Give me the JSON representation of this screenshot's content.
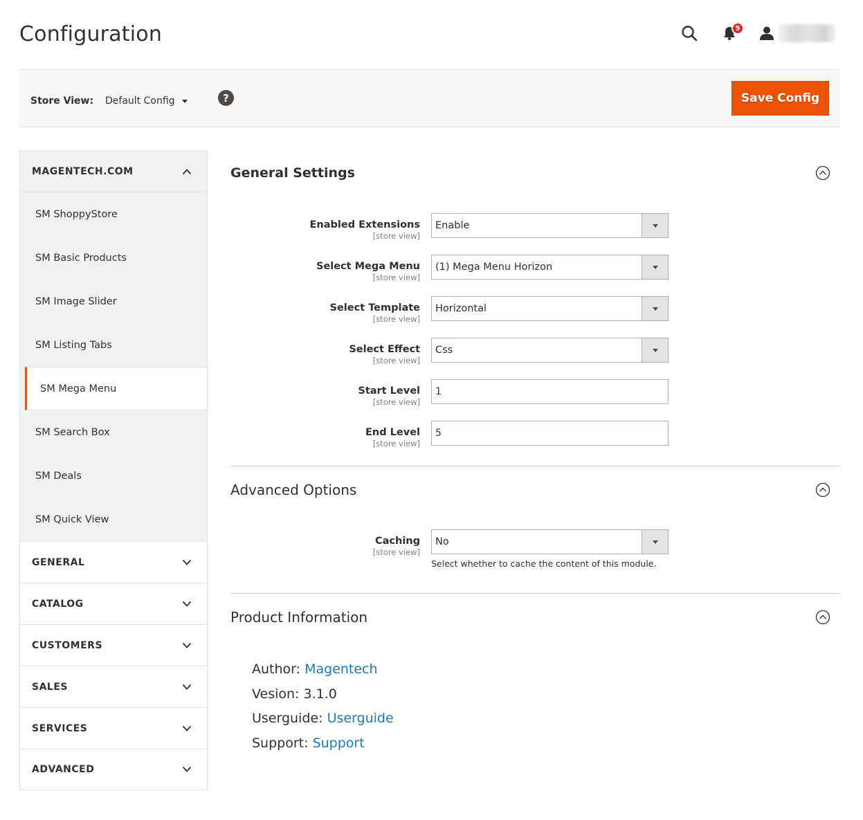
{
  "header": {
    "title": "Configuration",
    "notifications_count": "5",
    "icons": [
      "search-icon",
      "bell-icon",
      "user-icon"
    ]
  },
  "toolbar": {
    "store_label": "Store View:",
    "store_value": "Default Config",
    "help": "?",
    "save_label": "Save Config"
  },
  "sidebar": {
    "groups": [
      {
        "label": "MAGENTECH.COM",
        "expanded": true
      },
      {
        "label": "GENERAL"
      },
      {
        "label": "CATALOG"
      },
      {
        "label": "CUSTOMERS"
      },
      {
        "label": "SALES"
      },
      {
        "label": "SERVICES"
      },
      {
        "label": "ADVANCED"
      }
    ],
    "items": [
      {
        "label": "SM ShoppyStore"
      },
      {
        "label": "SM Basic Products"
      },
      {
        "label": "SM Image Slider"
      },
      {
        "label": "SM Listing Tabs"
      },
      {
        "label": "SM Mega Menu",
        "active": true
      },
      {
        "label": "SM Search Box"
      },
      {
        "label": "SM Deals"
      },
      {
        "label": "SM Quick View"
      }
    ]
  },
  "general": {
    "title": "General Settings",
    "fields": [
      {
        "label": "Enabled Extensions",
        "scope": "[store view]",
        "value": "Enable"
      },
      {
        "label": "Select Mega Menu",
        "scope": "[store view]",
        "value": "(1) Mega Menu Horizon"
      },
      {
        "label": "Select Template",
        "scope": "[store view]",
        "value": "Horizontal"
      },
      {
        "label": "Select Effect",
        "scope": "[store view]",
        "value": "Css"
      },
      {
        "label": "Start Level",
        "scope": "[store view]",
        "value": "1"
      },
      {
        "label": "End Level",
        "scope": "[store view]",
        "value": "5"
      }
    ]
  },
  "advanced": {
    "title": "Advanced Options",
    "caching": {
      "label": "Caching",
      "scope": "[store view]",
      "value": "No",
      "note": "Select whether to cache the content of this module."
    }
  },
  "product": {
    "title": "Product Information",
    "author_label": "Author:",
    "author_link": "Magentech",
    "version_label": "Vesion: 3.1.0",
    "guide_label": "Userguide:",
    "guide_link": "Userguide",
    "support_label": "Support:",
    "support_link": "Support"
  },
  "colors": {
    "accent": "#eb5202",
    "link": "#1979c3",
    "badge": "#e22626"
  }
}
